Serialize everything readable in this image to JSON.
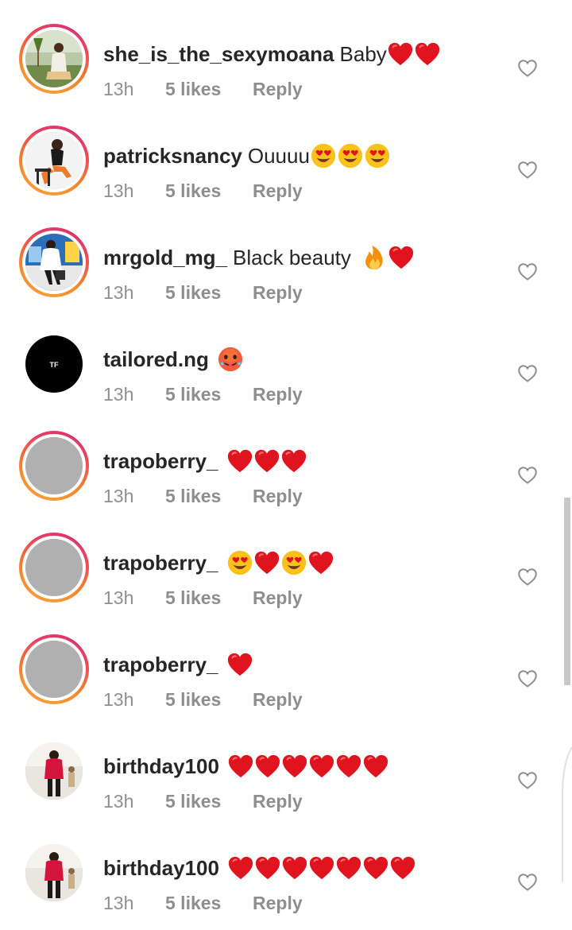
{
  "comments": [
    {
      "username": "she_is_the_sexymoana",
      "text": "Baby",
      "emojis": [
        "red-heart",
        "red-heart"
      ],
      "time": "13h",
      "likes": "5 likes",
      "reply": "Reply",
      "avatar": "woman-in-garden",
      "story": true
    },
    {
      "username": "patricksnancy",
      "text": "Ouuuu",
      "emojis": [
        "heart-eyes",
        "heart-eyes",
        "heart-eyes"
      ],
      "time": "13h",
      "likes": "5 likes",
      "reply": "Reply",
      "avatar": "woman-seated",
      "story": true
    },
    {
      "username": "mrgold_mg_",
      "text": "Black beauty",
      "emojis": [
        "fire",
        "red-heart"
      ],
      "time": "13h",
      "likes": "5 likes",
      "reply": "Reply",
      "avatar": "man-in-white",
      "story": true
    },
    {
      "username": "tailored.ng",
      "text": "",
      "emojis": [
        "hot-face"
      ],
      "time": "13h",
      "likes": "5 likes",
      "reply": "Reply",
      "avatar": "tailored-logo",
      "story": false
    },
    {
      "username": "trapoberry_",
      "text": "",
      "emojis": [
        "red-heart",
        "red-heart",
        "red-heart"
      ],
      "time": "13h",
      "likes": "5 likes",
      "reply": "Reply",
      "avatar": "default-grey",
      "story": true
    },
    {
      "username": "trapoberry_",
      "text": "",
      "emojis": [
        "heart-eyes",
        "red-heart",
        "heart-eyes",
        "red-heart"
      ],
      "time": "13h",
      "likes": "5 likes",
      "reply": "Reply",
      "avatar": "default-grey",
      "story": true
    },
    {
      "username": "trapoberry_",
      "text": "",
      "emojis": [
        "red-heart"
      ],
      "time": "13h",
      "likes": "5 likes",
      "reply": "Reply",
      "avatar": "default-grey",
      "story": true
    },
    {
      "username": "birthday100",
      "text": "",
      "emojis": [
        "red-heart",
        "red-heart",
        "red-heart",
        "red-heart",
        "red-heart",
        "red-heart"
      ],
      "time": "13h",
      "likes": "5 likes",
      "reply": "Reply",
      "avatar": "man-in-red",
      "story": false
    },
    {
      "username": "birthday100",
      "text": "",
      "emojis": [
        "red-heart",
        "red-heart",
        "red-heart",
        "red-heart",
        "red-heart",
        "red-heart",
        "red-heart"
      ],
      "time": "13h",
      "likes": "5 likes",
      "reply": "Reply",
      "avatar": "man-in-red",
      "story": false
    }
  ],
  "logo_text": "TF",
  "colors": {
    "text": "#262626",
    "meta": "#8e8e8e",
    "heart": "#e0141e",
    "story_ring_start": "#d62976",
    "story_ring_end": "#f6a63a"
  }
}
